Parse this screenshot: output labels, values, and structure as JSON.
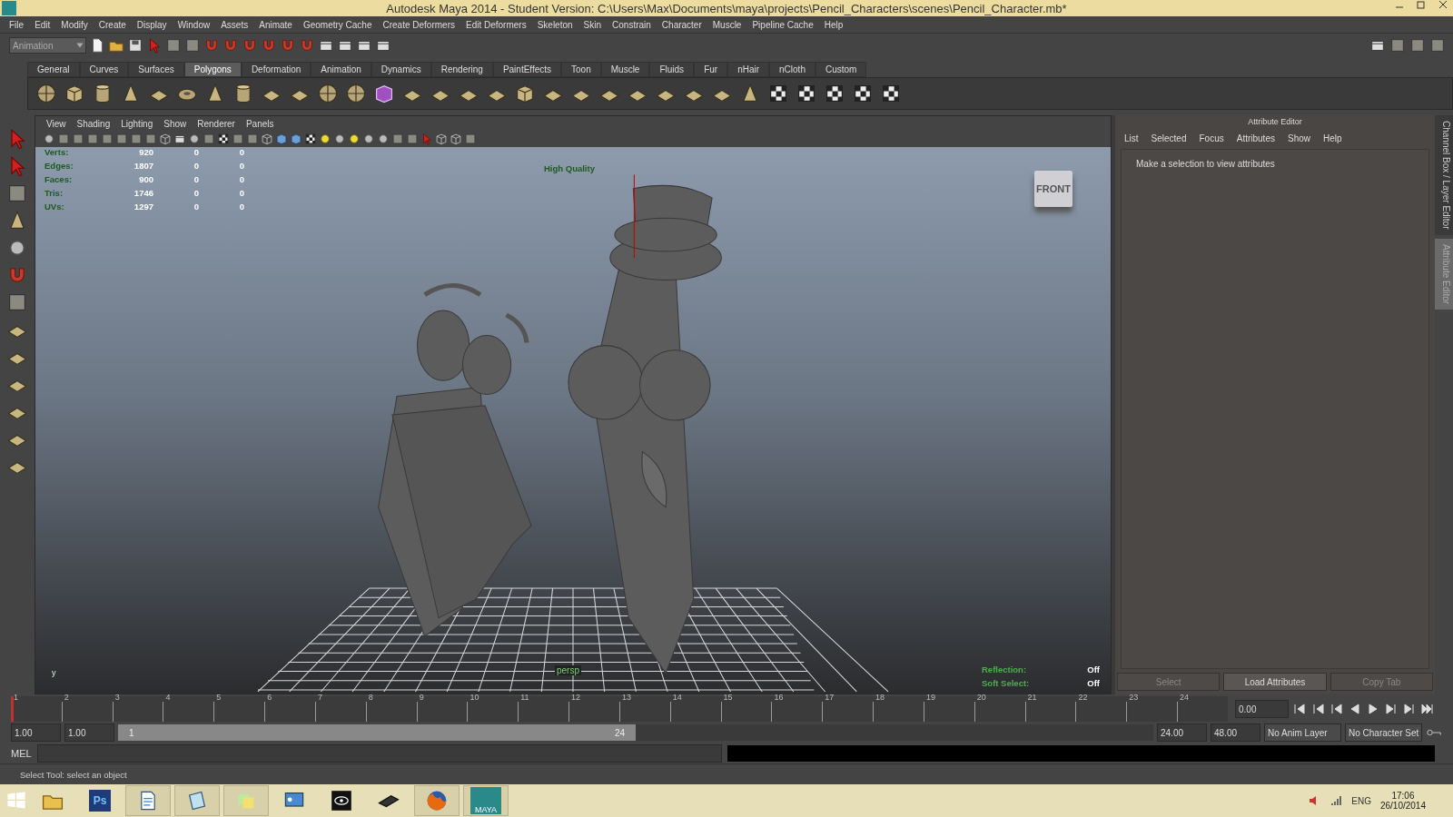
{
  "window": {
    "title": "Autodesk Maya 2014 - Student Version: C:\\Users\\Max\\Documents\\maya\\projects\\Pencil_Characters\\scenes\\Pencil_Character.mb*"
  },
  "menu_bar": [
    "File",
    "Edit",
    "Modify",
    "Create",
    "Display",
    "Window",
    "Assets",
    "Animate",
    "Geometry Cache",
    "Create Deformers",
    "Edit Deformers",
    "Skeleton",
    "Skin",
    "Constrain",
    "Character",
    "Muscle",
    "Pipeline Cache",
    "Help"
  ],
  "status_line": {
    "mode": "Animation"
  },
  "shelf": {
    "tabs": [
      {
        "label": "General",
        "selected": false
      },
      {
        "label": "Curves",
        "selected": false
      },
      {
        "label": "Surfaces",
        "selected": false
      },
      {
        "label": "Polygons",
        "selected": true
      },
      {
        "label": "Deformation",
        "selected": false
      },
      {
        "label": "Animation",
        "selected": false
      },
      {
        "label": "Dynamics",
        "selected": false
      },
      {
        "label": "Rendering",
        "selected": false
      },
      {
        "label": "PaintEffects",
        "selected": false
      },
      {
        "label": "Toon",
        "selected": false
      },
      {
        "label": "Muscle",
        "selected": false
      },
      {
        "label": "Fluids",
        "selected": false
      },
      {
        "label": "Fur",
        "selected": false
      },
      {
        "label": "nHair",
        "selected": false
      },
      {
        "label": "nCloth",
        "selected": false
      },
      {
        "label": "Custom",
        "selected": false
      }
    ]
  },
  "viewport": {
    "menu": [
      "View",
      "Shading",
      "Lighting",
      "Show",
      "Renderer",
      "Panels"
    ],
    "stats": [
      {
        "label": "Verts:",
        "values": [
          "920",
          "0",
          "0"
        ]
      },
      {
        "label": "Edges:",
        "values": [
          "1807",
          "0",
          "0"
        ]
      },
      {
        "label": "Faces:",
        "values": [
          "900",
          "0",
          "0"
        ]
      },
      {
        "label": "Tris:",
        "values": [
          "1746",
          "0",
          "0"
        ]
      },
      {
        "label": "UVs:",
        "values": [
          "1297",
          "0",
          "0"
        ]
      }
    ],
    "quality": "High Quality",
    "view_cube": "FRONT",
    "camera": "persp",
    "axis_label": "y",
    "settings": [
      {
        "label": "Reflection:",
        "value": "Off"
      },
      {
        "label": "Soft Select:",
        "value": "Off"
      }
    ]
  },
  "attribute_editor": {
    "title": "Attribute Editor",
    "menu": [
      "List",
      "Selected",
      "Focus",
      "Attributes",
      "Show",
      "Help"
    ],
    "message": "Make a selection to view attributes",
    "buttons": [
      {
        "label": "Select",
        "disabled": true
      },
      {
        "label": "Load Attributes",
        "disabled": false
      },
      {
        "label": "Copy Tab",
        "disabled": true
      }
    ]
  },
  "side_tabs": [
    {
      "label": "Channel Box / Layer Editor",
      "selected": false
    },
    {
      "label": "Attribute Editor",
      "selected": true
    }
  ],
  "timeline": {
    "ticks": [
      "1",
      "2",
      "3",
      "4",
      "5",
      "6",
      "7",
      "8",
      "9",
      "10",
      "11",
      "12",
      "13",
      "14",
      "15",
      "16",
      "17",
      "18",
      "19",
      "20",
      "21",
      "22",
      "23",
      "24"
    ],
    "current_time": "0.00",
    "level": 0
  },
  "range": {
    "start": "1.00",
    "playback_start": "1.00",
    "slider_start": "1",
    "slider_end": "24",
    "playback_end": "24.00",
    "end": "48.00",
    "anim_layer": "No Anim Layer",
    "character_set": "No Character Set",
    "level": 0.5
  },
  "command_line": {
    "label": "MEL"
  },
  "help_line": "Select Tool: select an object",
  "taskbar": {
    "apps": [
      {
        "kind": "explorer",
        "running": false
      },
      {
        "kind": "photoshop",
        "label": "Ps",
        "running": false
      },
      {
        "kind": "wordpad",
        "running": true
      },
      {
        "kind": "notepad",
        "running": true
      },
      {
        "kind": "sticky",
        "running": true
      },
      {
        "kind": "control",
        "running": false
      },
      {
        "kind": "eye",
        "running": false
      },
      {
        "kind": "tablet",
        "running": false
      },
      {
        "kind": "firefox",
        "running": true
      },
      {
        "kind": "maya",
        "label": "MAYA",
        "running": true
      }
    ],
    "language": "ENG",
    "time": "17:06",
    "date": "26/10/2014"
  }
}
